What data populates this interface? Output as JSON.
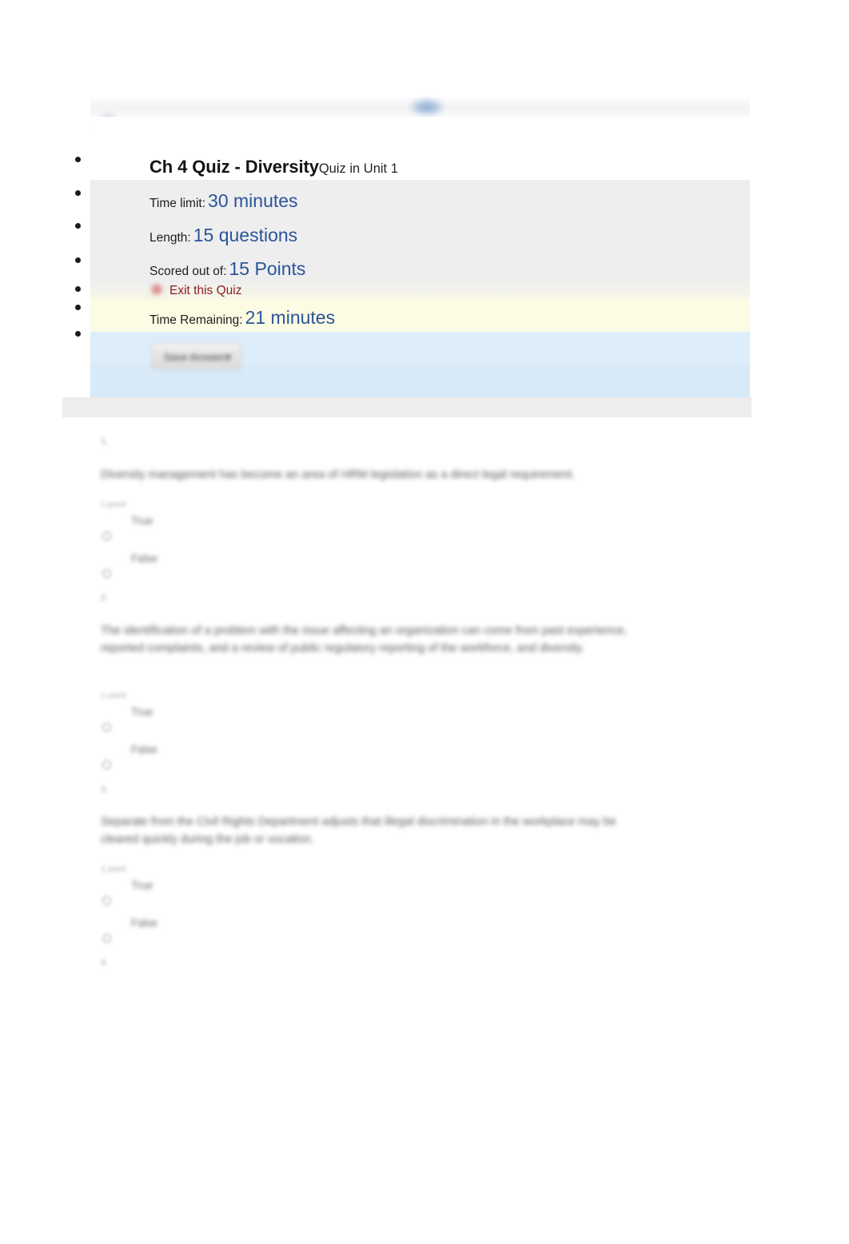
{
  "browser_chrome": {
    "badge_icon": "blue-oval-badge",
    "back_icon": "blue-crescent-icon"
  },
  "quiz": {
    "title": "Ch 4 Quiz - Diversity",
    "subtitle": "Quiz in Unit 1",
    "rows": [
      {
        "label": "Time limit:",
        "value": "30 minutes"
      },
      {
        "label": "Length:",
        "value": "15 questions"
      },
      {
        "label": "Scored out of:",
        "value": "15 Points"
      }
    ],
    "exit": {
      "label": "Exit this Quiz",
      "icon": "exit-circle-icon",
      "color": "#8c1d1d"
    },
    "time_remaining": {
      "label": "Time Remaining:",
      "value": "21 minutes"
    },
    "action_button": {
      "label": "Save Answers",
      "caret_icon": "chevron-down-icon"
    },
    "accent_color": "#2a5599",
    "yellow_band_color": "#fcfbe3",
    "blue_band_color": "#ddedfa",
    "panel_color": "#eeeeef"
  },
  "questions": [
    {
      "number": "1.",
      "points": "1 point",
      "text": "Diversity management has become an area of HRM legislation as a direct legal requirement.",
      "options": [
        {
          "label": "True"
        },
        {
          "label": "False"
        }
      ],
      "footer": "2."
    },
    {
      "number": "2.",
      "points": "1 point",
      "text": "The identification of a problem with the issue affecting an organization can come from past experience, reported complaints, and a review of public regulatory reporting of the workforce, and diversity.",
      "options": [
        {
          "label": "True"
        },
        {
          "label": "False"
        }
      ],
      "footer": "3."
    },
    {
      "number": "3.",
      "points": "1 point",
      "text": "Separate from the Civil Rights Department adjusts that illegal discrimination in the workplace may be cleared quickly during the job or vocation.",
      "options": [
        {
          "label": "True"
        },
        {
          "label": "False"
        }
      ],
      "footer": "4."
    }
  ]
}
